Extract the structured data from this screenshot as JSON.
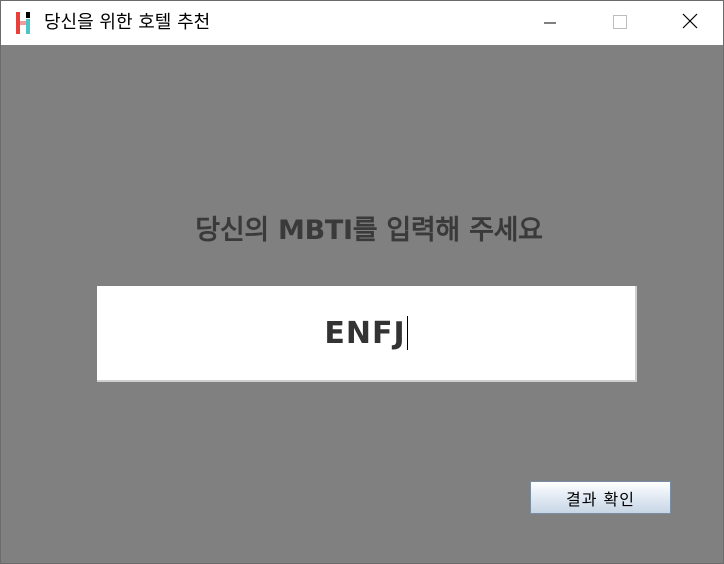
{
  "window": {
    "title": "당신을 위한 호텔 추천",
    "icon": "app-logo-icon",
    "controls": [
      "minimize-icon",
      "maximize-icon",
      "close-icon"
    ]
  },
  "form": {
    "prompt": "당신의 MBTI를 입력해 주세요",
    "mbti_value": "ENFJ",
    "submit_label": "결과 확인"
  },
  "colors": {
    "background": "#808080",
    "titlebar": "#ffffff",
    "prompt_text": "#3a3a3a",
    "input_bg": "#ffffff",
    "button_top": "#ffffff",
    "button_bottom": "#c8d6e5"
  }
}
